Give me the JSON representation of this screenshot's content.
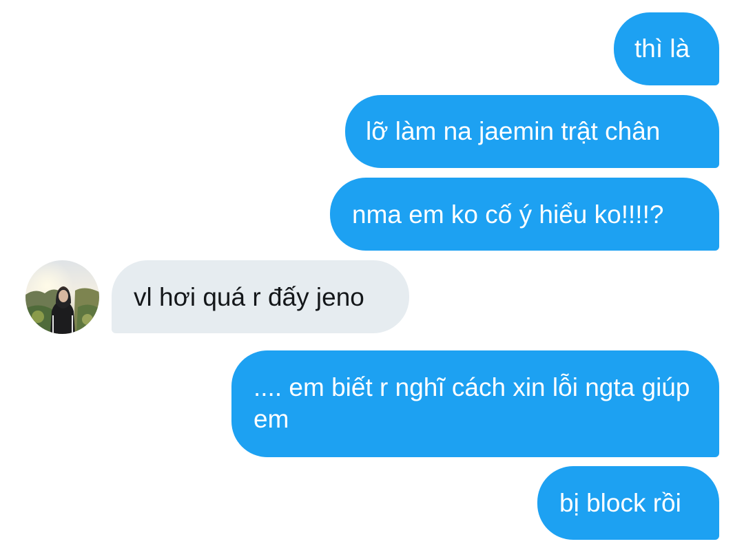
{
  "conversation": {
    "messages": [
      {
        "sender": "self",
        "text": "thì là"
      },
      {
        "sender": "self",
        "text": "lỡ làm na jaemin trật chân"
      },
      {
        "sender": "self",
        "text": "nma em ko cố ý hiểu ko!!!!?"
      },
      {
        "sender": "other",
        "text": "vl hơi quá r đấy jeno"
      },
      {
        "sender": "self",
        "text": ".... em biết r nghĩ cách xin lỗi ngta giúp em"
      },
      {
        "sender": "self",
        "text": "bị block rồi"
      }
    ]
  },
  "colors": {
    "outgoing_bubble": "#1DA1F2",
    "incoming_bubble": "#E6ECF0",
    "outgoing_text": "#FFFFFF",
    "incoming_text": "#14171A"
  },
  "icons": {
    "avatar": "user-avatar-photo"
  }
}
